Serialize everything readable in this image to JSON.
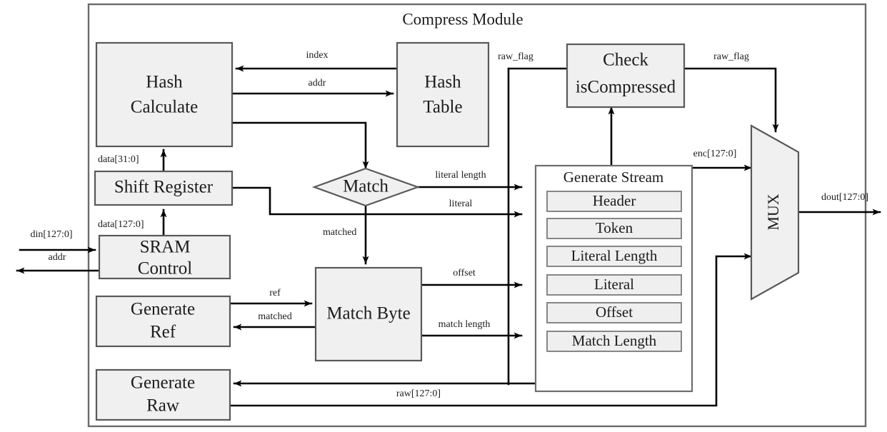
{
  "diagram": {
    "title": "Compress Module",
    "blocks": {
      "hash_calculate": "Hash\nCalculate",
      "hash_calculate_l1": "Hash",
      "hash_calculate_l2": "Calculate",
      "hash_table_l1": "Hash",
      "hash_table_l2": "Table",
      "check_is_compressed_l1": "Check",
      "check_is_compressed_l2": "isCompressed",
      "shift_register": "Shift Register",
      "sram_control_l1": "SRAM",
      "sram_control_l2": "Control",
      "generate_ref_l1": "Generate",
      "generate_ref_l2": "Ref",
      "generate_raw_l1": "Generate",
      "generate_raw_l2": "Raw",
      "match": "Match",
      "match_byte": "Match Byte",
      "generate_stream": "Generate Stream",
      "mux": "MUX"
    },
    "stream_fields": [
      "Header",
      "Token",
      "Literal Length",
      "Literal",
      "Offset",
      "Match Length"
    ],
    "signals": {
      "index": "index",
      "addr_hash": "addr",
      "raw_flag_in": "raw_flag",
      "raw_flag_out": "raw_flag",
      "enc": "enc[127:0]",
      "dout": "dout[127:0]",
      "data31": "data[31:0]",
      "data127": "data[127:0]",
      "din": "din[127:0]",
      "addr_out": "addr",
      "literal_length": "literal length",
      "literal": "literal",
      "matched_down": "matched",
      "ref": "ref",
      "matched_back": "matched",
      "offset": "offset",
      "match_length": "match length",
      "raw": "raw[127:0]"
    },
    "colors": {
      "block_fill": "#f0f0f0",
      "block_stroke": "#595959",
      "wire": "#000000",
      "frame": "#6b6b6b",
      "background": "#ffffff"
    }
  }
}
